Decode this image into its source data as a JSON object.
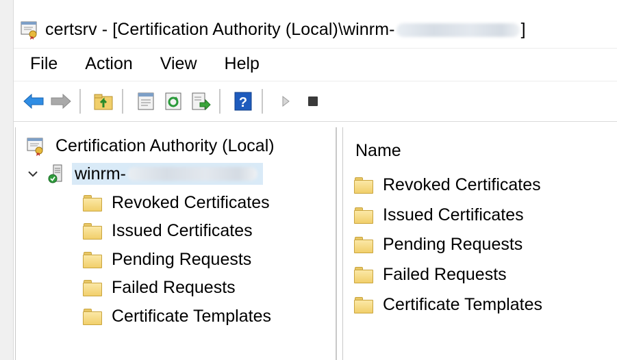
{
  "window": {
    "title_prefix": "certsrv - [Certification Authority (Local)\\winrm-",
    "title_suffix": "]"
  },
  "menu": [
    "File",
    "Action",
    "View",
    "Help"
  ],
  "toolbar_icons": [
    "back-arrow-icon",
    "forward-arrow-icon",
    "up-folder-icon",
    "properties-icon",
    "refresh-icon",
    "export-list-icon",
    "help-icon",
    "start-service-icon",
    "stop-service-icon"
  ],
  "tree": {
    "root": "Certification Authority (Local)",
    "ca_node_prefix": "winrm-",
    "children": [
      "Revoked Certificates",
      "Issued Certificates",
      "Pending Requests",
      "Failed Requests",
      "Certificate Templates"
    ]
  },
  "list": {
    "column_name": "Name",
    "items": [
      "Revoked Certificates",
      "Issued Certificates",
      "Pending Requests",
      "Failed Requests",
      "Certificate Templates"
    ]
  },
  "colors": {
    "selection": "#d9eaf7",
    "back_arrow": "#2f8de4",
    "help_blue": "#1e5bbd",
    "folder": "#f1cf6b"
  }
}
